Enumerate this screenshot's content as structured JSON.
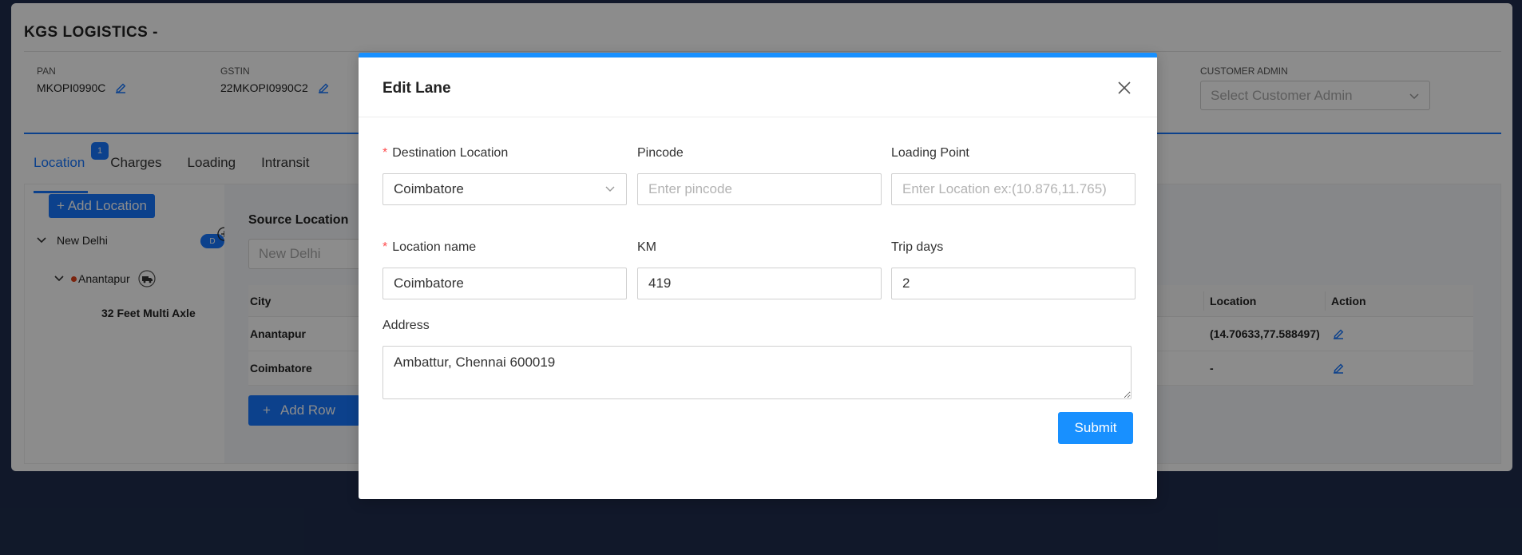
{
  "page": {
    "company": "KGS LOGISTICS -",
    "pan": {
      "label": "PAN",
      "value": "MKOPI0990C"
    },
    "gstin": {
      "label": "GSTIN",
      "value": "22MKOPI0990C2"
    },
    "customer_admin": {
      "label": "CUSTOMER ADMIN",
      "placeholder": "Select Customer Admin"
    }
  },
  "tabs": [
    {
      "label": "Location",
      "badge": "1",
      "active": true
    },
    {
      "label": "Charges"
    },
    {
      "label": "Loading"
    },
    {
      "label": "Intransit"
    }
  ],
  "left_panel": {
    "add_location_label": "+ Add Location",
    "tree": {
      "root": "New Delhi",
      "root_badge": "D",
      "child": "Anantapur",
      "grandchild": "32 Feet Multi Axle"
    }
  },
  "right_panel": {
    "source_label": "Source Location",
    "source_placeholder": "New Delhi",
    "table": {
      "headers": {
        "city": "City",
        "location": "Location",
        "action": "Action"
      },
      "rows": [
        {
          "city": "Anantapur",
          "location": "(14.70633,77.588497)"
        },
        {
          "city": "Coimbatore",
          "location": "-"
        }
      ]
    },
    "add_row_label": "Add Row"
  },
  "modal": {
    "title": "Edit Lane",
    "fields": {
      "destination": {
        "label": "Destination Location",
        "value": "Coimbatore",
        "required": true
      },
      "pincode": {
        "label": "Pincode",
        "placeholder": "Enter pincode",
        "value": ""
      },
      "loading_point": {
        "label": "Loading Point",
        "placeholder": "Enter Location ex:(10.876,11.765)",
        "value": ""
      },
      "location_name": {
        "label": "Location name",
        "value": "Coimbatore",
        "required": true
      },
      "km": {
        "label": "KM",
        "value": "419"
      },
      "trip_days": {
        "label": "Trip days",
        "value": "2"
      },
      "address": {
        "label": "Address",
        "value": "Ambattur, Chennai 600019"
      }
    },
    "submit_label": "Submit"
  },
  "colors": {
    "primary": "#1890ff",
    "required": "#ff4d4f",
    "overlay": "rgba(0,0,0,0.45)"
  }
}
